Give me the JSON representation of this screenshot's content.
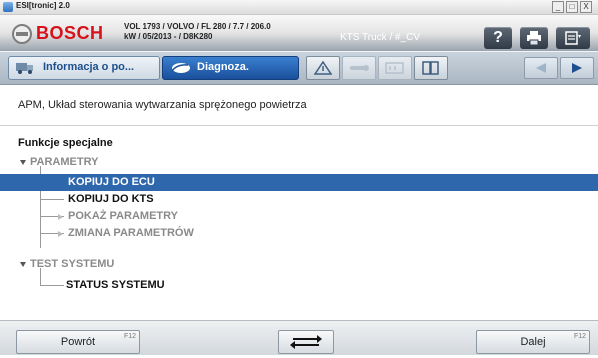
{
  "window": {
    "title": "ESI[tronic] 2.0",
    "controls": [
      "_",
      "□",
      "X"
    ]
  },
  "header": {
    "brand": "BOSCH",
    "vehicle_line1": "VOL 1793 / VOLVO / FL 280 / 7.7 / 206.0",
    "vehicle_line2": "kW / 05/2013 - / D8K280",
    "device": "KTS Truck / #_CV",
    "help_label": "?"
  },
  "toolbar": {
    "tabs": [
      {
        "label": "Informacja o po...",
        "icon": "info-truck-icon",
        "active": false
      },
      {
        "label": "Diagnoza.",
        "icon": "stethoscope-icon",
        "active": true
      }
    ],
    "tools": [
      "component-icon",
      "wrench-icon",
      "battery-icon",
      "book-icon"
    ],
    "nav": [
      "arrow-left-icon",
      "arrow-right-icon"
    ]
  },
  "content": {
    "subtitle": "APM, Układ sterowania wytwarzania sprężonego powietrza",
    "section": "Funkcje specjalne",
    "tree": [
      {
        "label": "PARAMETRY",
        "level": 0,
        "state": "group"
      },
      {
        "label": "KOPIUJ DO ECU",
        "level": 1,
        "state": "selected"
      },
      {
        "label": "KOPIUJ DO KTS",
        "level": 1,
        "state": "enabled"
      },
      {
        "label": "POKAŻ PARAMETRY",
        "level": 1,
        "state": "disabled"
      },
      {
        "label": "ZMIANA PARAMETRÓW",
        "level": 1,
        "state": "disabled"
      },
      {
        "label": "TEST SYSTEMU",
        "level": 0,
        "state": "group"
      },
      {
        "label": "STATUS SYSTEMU",
        "level": 1,
        "state": "enabled"
      }
    ]
  },
  "bottom": {
    "back_label": "Powrót",
    "back_key": "F12",
    "switch_icon": "swap-arrows-icon",
    "next_label": "Dalej",
    "next_key": "F12"
  },
  "colors": {
    "brand_red": "#d8111b",
    "selection_blue": "#2f67ad",
    "active_tab_blue": "#1a4f9b"
  }
}
